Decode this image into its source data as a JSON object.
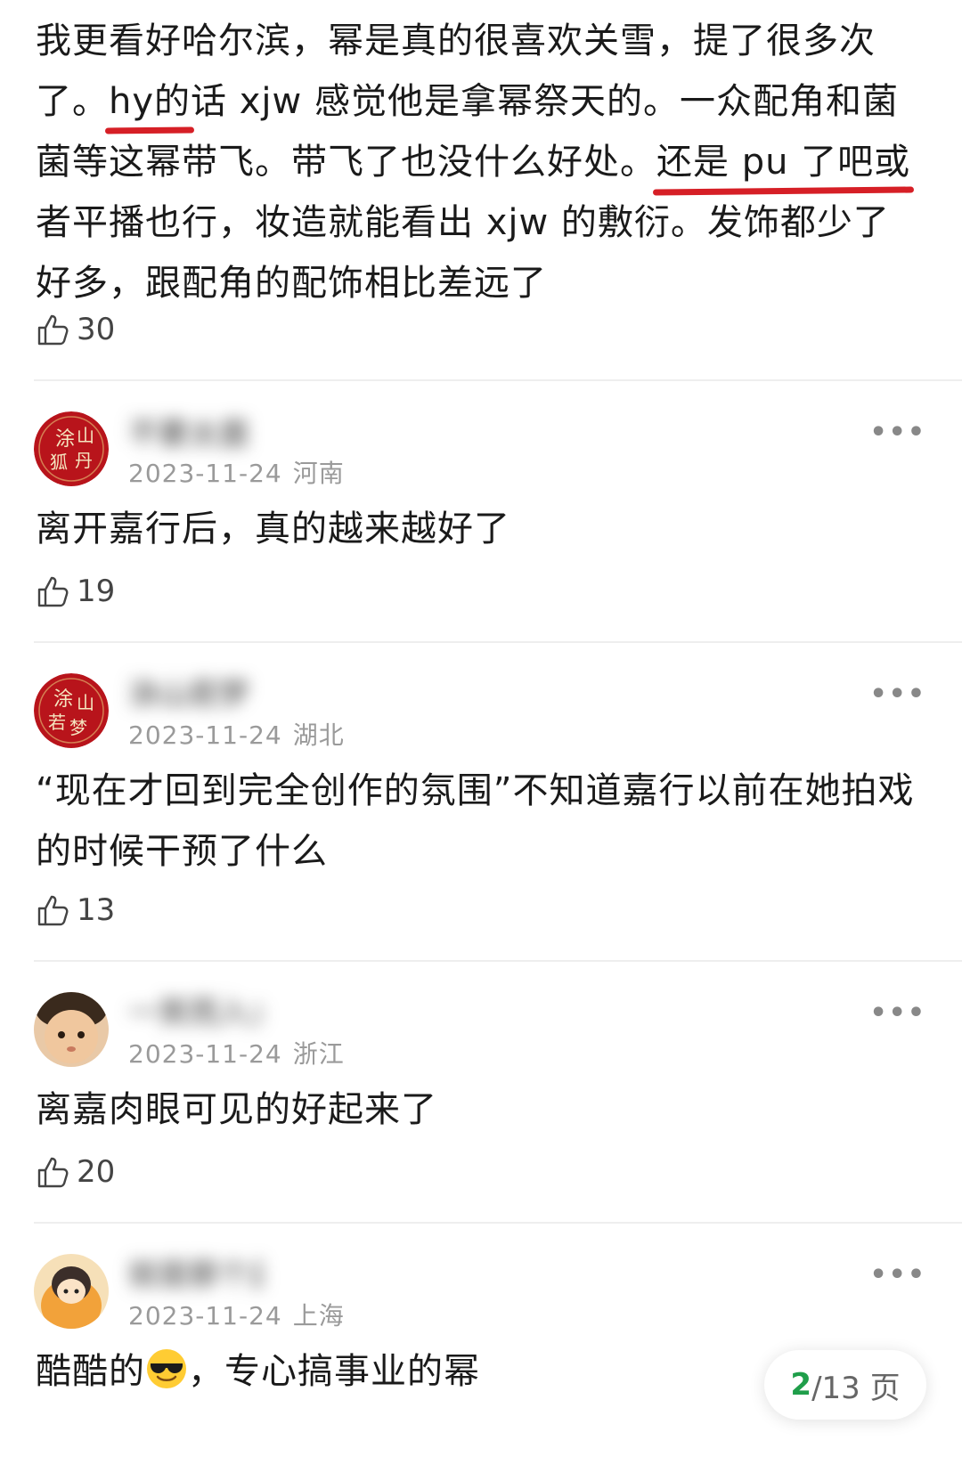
{
  "top_comment": {
    "lines": [
      [
        "我更看好哈尔滨，幂是真的很喜欢关雪，提了很多次"
      ],
      [
        "了。",
        "hy的",
        "话 xjw 感觉他是拿幂祭天的。一众配角和菌"
      ],
      [
        "菌等这幂带飞。带飞了也没什么好处。",
        "还是 pu 了吧或",
        ""
      ],
      [
        "者平播也行，妆造就能看出 xjw 的敷衍。发饰都少了"
      ],
      [
        "好多，跟配角的配饰相比差远了"
      ]
    ],
    "likes": "30"
  },
  "comments": [
    {
      "username": "不要太嚣",
      "date": "2023-11-24",
      "location": "河南",
      "text": "离开嘉行后，真的越来越好了",
      "likes": "19",
      "avatar_text": [
        "涂",
        "山",
        "狐",
        "丹"
      ]
    },
    {
      "username": "涂山若梦",
      "date": "2023-11-24",
      "location": "湖北",
      "text": "“现在才回到完全创作的氛围”不知道嘉行以前在她拍戏的时候干预了什么",
      "likes": "13",
      "avatar_text": [
        "涂",
        "山",
        "若",
        "梦"
      ]
    },
    {
      "username": "一笑而入大",
      "date": "2023-11-24",
      "location": "浙江",
      "text": "离嘉肉眼可见的好起来了",
      "likes": "20"
    },
    {
      "username": "就是那个盖子",
      "date": "2023-11-24",
      "location": "上海",
      "text_before": "酷酷的",
      "emoji": "sunglasses-emoji",
      "text_after": "，专心搞事业的幂"
    }
  ],
  "more_icon": "•••",
  "pager": {
    "current": "2",
    "total_label": "/13 页"
  },
  "colors": {
    "highlight": "#d61f26",
    "pager_current": "#1f9e4a",
    "avatar_red": "#b8141b"
  }
}
